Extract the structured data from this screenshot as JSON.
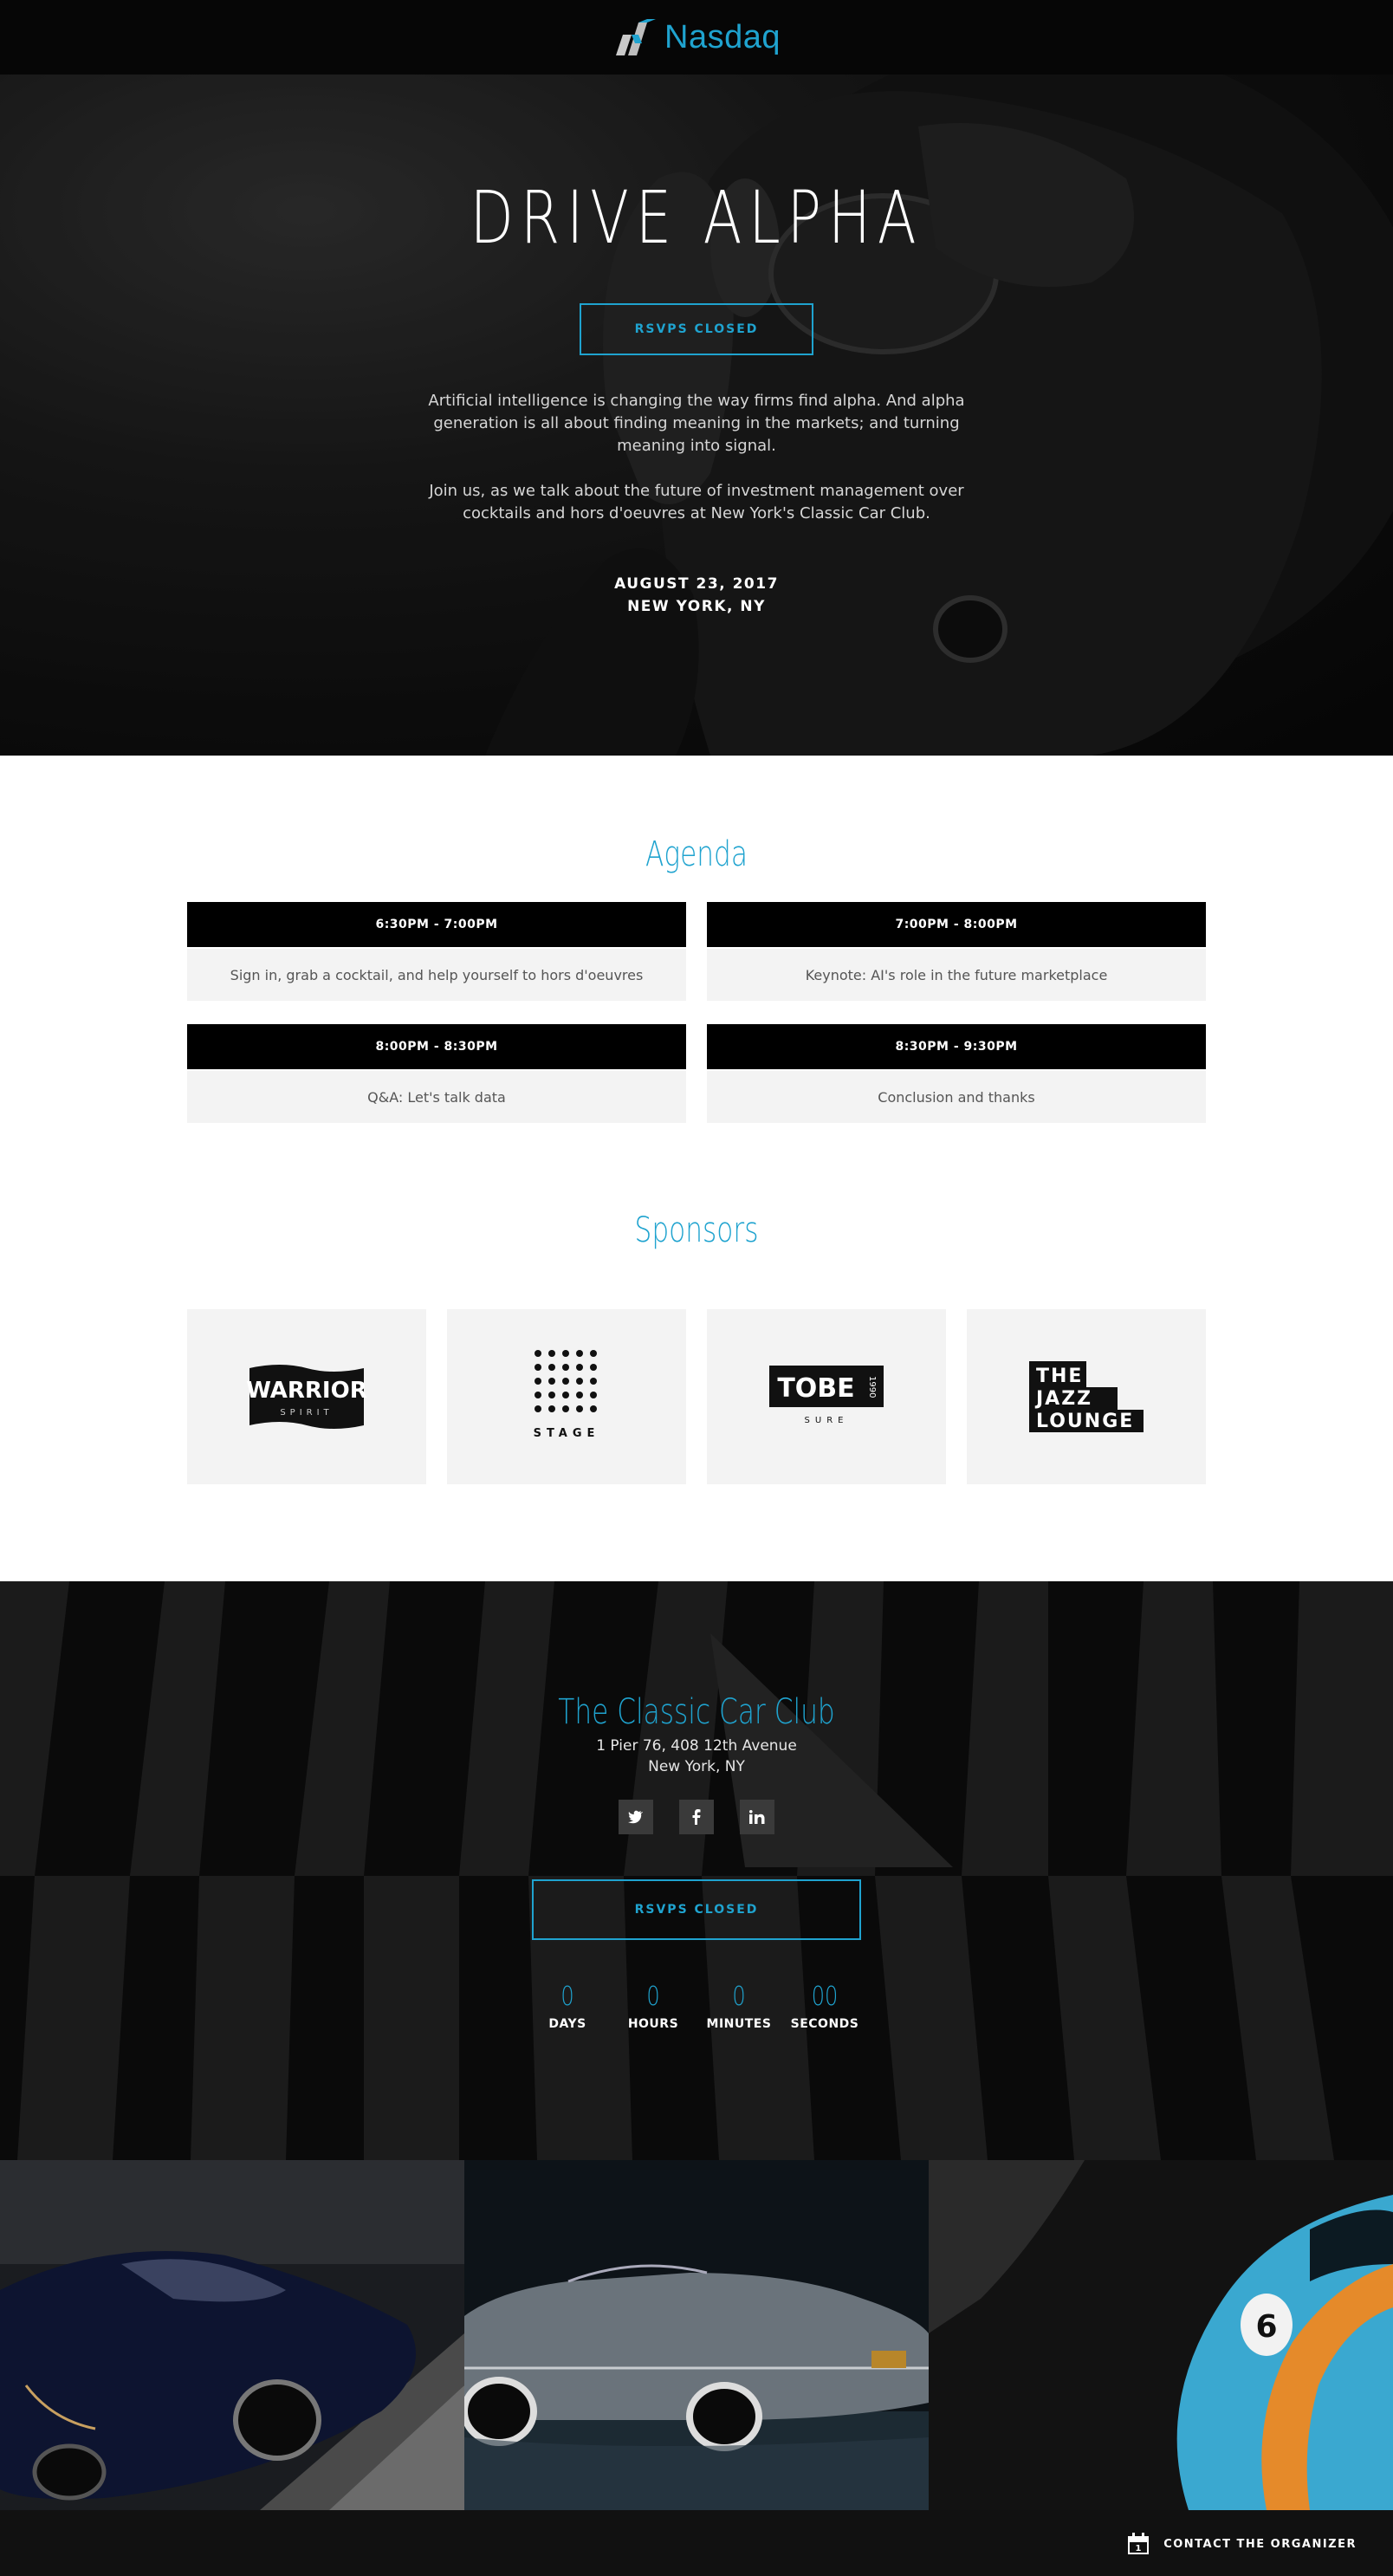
{
  "header": {
    "logo_text": "Nasdaq"
  },
  "hero": {
    "title": "DRIVE ALPHA",
    "button": "RSVPS CLOSED",
    "paragraph1": "Artificial intelligence is changing the way firms find alpha. And alpha generation is all about finding meaning in the markets; and turning meaning into signal.",
    "paragraph2": "Join us, as we talk about the future of investment management over cocktails and hors d'oeuvres at New York's Classic Car Club.",
    "date": "AUGUST 23, 2017",
    "location": "NEW YORK, NY"
  },
  "agenda": {
    "title": "Agenda",
    "items": [
      {
        "time": "6:30PM - 7:00PM",
        "desc": "Sign in, grab a cocktail, and help yourself to hors d'oeuvres"
      },
      {
        "time": "7:00PM - 8:00PM",
        "desc": "Keynote: AI's role in the future marketplace"
      },
      {
        "time": "8:00PM - 8:30PM",
        "desc": "Q&A: Let's talk data"
      },
      {
        "time": "8:30PM - 9:30PM",
        "desc": "Conclusion and thanks"
      }
    ]
  },
  "sponsors": {
    "title": "Sponsors",
    "logos": [
      {
        "name": "WARRIOR",
        "sub": "SPIRIT"
      },
      {
        "name": "STAGE"
      },
      {
        "name": "TOBE",
        "side": "1990",
        "sub": "SURE"
      },
      {
        "lines": [
          "THE",
          "JAZZ",
          "LOUNGE"
        ]
      }
    ]
  },
  "venue": {
    "name": "The Classic Car Club",
    "address1": "1 Pier 76, 408 12th Avenue",
    "address2": "New York, NY",
    "social": [
      "twitter-icon",
      "facebook-icon",
      "linkedin-icon"
    ],
    "button": "RSVPS CLOSED",
    "countdown": [
      {
        "value": "0",
        "label": "DAYS"
      },
      {
        "value": "0",
        "label": "HOURS"
      },
      {
        "value": "0",
        "label": "MINUTES"
      },
      {
        "value": "00",
        "label": "SECONDS"
      }
    ]
  },
  "photos": [
    "dark-convertible-photo",
    "silver-convertible-photo",
    "blue-race-car-photo"
  ],
  "footer": {
    "contact_label": "CONTACT THE ORGANIZER",
    "calendar_day": "1"
  },
  "colors": {
    "accent": "#1fa3cf",
    "dark": "#000000",
    "card": "#f3f3f3"
  }
}
